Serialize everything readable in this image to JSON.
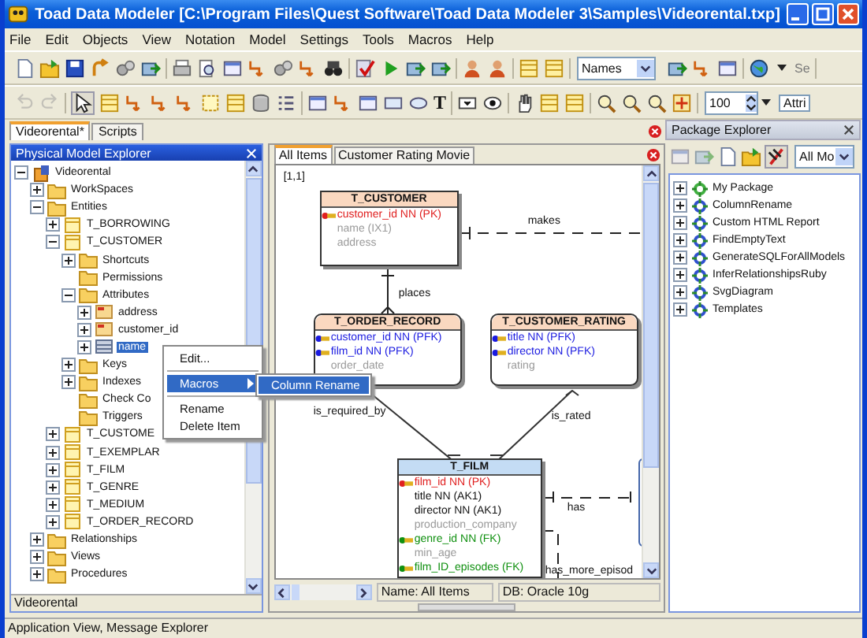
{
  "window": {
    "title": "Toad Data Modeler  [C:\\Program Files\\Quest Software\\Toad Data Modeler 3\\Samples\\Videorental.txp]"
  },
  "menu": [
    "File",
    "Edit",
    "Objects",
    "View",
    "Notation",
    "Model",
    "Settings",
    "Tools",
    "Macros",
    "Help"
  ],
  "toolbar": {
    "names_select": "Names",
    "search_text": "Se",
    "text_tool": "T",
    "zoom_value": "100",
    "attr_select": "Attri"
  },
  "document_tabs": [
    {
      "label": "Videorental*",
      "selected": true
    },
    {
      "label": "Scripts",
      "selected": false
    }
  ],
  "model_explorer": {
    "title": "Physical Model Explorer",
    "status": "Videorental",
    "tree": [
      {
        "label": "Videorental",
        "kind": "model",
        "expanded": true,
        "selected": false,
        "children": [
          {
            "label": "WorkSpaces",
            "kind": "folder",
            "expanded": false,
            "selected": false
          },
          {
            "label": "Entities",
            "kind": "folder",
            "expanded": true,
            "selected": false,
            "children": [
              {
                "label": "T_BORROWING",
                "kind": "entity",
                "expanded": false,
                "selected": false
              },
              {
                "label": "T_CUSTOMER",
                "kind": "entity",
                "expanded": true,
                "selected": false,
                "children": [
                  {
                    "label": "Shortcuts",
                    "kind": "folder",
                    "expanded": false,
                    "selected": false
                  },
                  {
                    "label": "Permissions",
                    "kind": "folder",
                    "selected": false
                  },
                  {
                    "label": "Attributes",
                    "kind": "folder",
                    "expanded": true,
                    "selected": false,
                    "children": [
                      {
                        "label": "address",
                        "kind": "key-attribute",
                        "expanded": false,
                        "selected": false
                      },
                      {
                        "label": "customer_id",
                        "kind": "key-attribute",
                        "expanded": false,
                        "selected": false
                      },
                      {
                        "label": "name",
                        "kind": "attribute",
                        "expanded": false,
                        "selected": true
                      }
                    ]
                  },
                  {
                    "label": "Keys",
                    "kind": "folder",
                    "expanded": false,
                    "selected": false
                  },
                  {
                    "label": "Indexes",
                    "kind": "folder",
                    "expanded": false,
                    "selected": false
                  },
                  {
                    "label": "Check Co",
                    "kind": "folder",
                    "selected": false
                  },
                  {
                    "label": "Triggers",
                    "kind": "folder",
                    "selected": false
                  }
                ]
              },
              {
                "label": "T_CUSTOME",
                "kind": "entity",
                "expanded": false,
                "selected": false
              },
              {
                "label": "T_EXEMPLAR",
                "kind": "entity",
                "expanded": false,
                "selected": false
              },
              {
                "label": "T_FILM",
                "kind": "entity",
                "expanded": false,
                "selected": false
              },
              {
                "label": "T_GENRE",
                "kind": "entity",
                "expanded": false,
                "selected": false
              },
              {
                "label": "T_MEDIUM",
                "kind": "entity",
                "expanded": false,
                "selected": false
              },
              {
                "label": "T_ORDER_RECORD",
                "kind": "entity",
                "expanded": false,
                "selected": false
              }
            ]
          },
          {
            "label": "Relationships",
            "kind": "folder",
            "expanded": false,
            "selected": false
          },
          {
            "label": "Views",
            "kind": "folder",
            "expanded": false,
            "selected": false
          },
          {
            "label": "Procedures",
            "kind": "folder",
            "expanded": false,
            "selected": false
          }
        ]
      }
    ]
  },
  "context_menu": {
    "items": [
      {
        "kind": "item",
        "label": "Edit...",
        "selected": false
      },
      {
        "kind": "separator"
      },
      {
        "kind": "submenu",
        "label": "Macros",
        "selected": true,
        "submenu": [
          {
            "label": "Column Rename",
            "selected": true
          }
        ]
      },
      {
        "kind": "separator"
      },
      {
        "kind": "item",
        "label": "Rename",
        "selected": false
      },
      {
        "kind": "item",
        "label": "Delete Item",
        "selected": false
      }
    ]
  },
  "diagram_tabs": [
    {
      "label": "All Items",
      "selected": true
    },
    {
      "label": "Customer Rating Movie",
      "selected": false
    }
  ],
  "diagram": {
    "corner_label": "[1,1]",
    "entities": [
      {
        "name": "T_CUSTOMER",
        "kind": "square",
        "selected": false,
        "attributes": [
          {
            "text": "customer_id NN (PK)",
            "kind": "pk"
          },
          {
            "text": "name (IX1)",
            "kind": "optional"
          },
          {
            "text": "address",
            "kind": "optional"
          }
        ]
      },
      {
        "name": "T_ORDER_RECORD",
        "kind": "rounded",
        "selected": false,
        "attributes": [
          {
            "text": "customer_id NN (PFK)",
            "kind": "pfk"
          },
          {
            "text": "film_id NN (PFK)",
            "kind": "pfk"
          },
          {
            "text": "order_date",
            "kind": "optional"
          }
        ]
      },
      {
        "name": "T_CUSTOMER_RATING",
        "kind": "rounded",
        "selected": false,
        "attributes": [
          {
            "text": "title NN (PFK)",
            "kind": "pfk"
          },
          {
            "text": "director NN (PFK)",
            "kind": "pfk"
          },
          {
            "text": "rating",
            "kind": "optional"
          }
        ]
      },
      {
        "name": "T_FILM",
        "kind": "square",
        "selected": true,
        "attributes": [
          {
            "text": "film_id NN (PK)",
            "kind": "pk"
          },
          {
            "text": "title NN (AK1)",
            "kind": "mandatory"
          },
          {
            "text": "director NN (AK1)",
            "kind": "mandatory"
          },
          {
            "text": "production_company",
            "kind": "optional"
          },
          {
            "text": "genre_id NN (FK)",
            "kind": "fk"
          },
          {
            "text": "min_age",
            "kind": "optional"
          },
          {
            "text": "film_ID_episodes (FK)",
            "kind": "fk"
          }
        ]
      }
    ],
    "relationships": [
      {
        "label": "makes",
        "identifying": false
      },
      {
        "label": "places",
        "identifying": true
      },
      {
        "label": "is_required_by",
        "identifying": true
      },
      {
        "label": "is_rated",
        "identifying": true
      },
      {
        "label": "has",
        "identifying": false
      },
      {
        "label": "has_more_episod",
        "identifying": false
      }
    ],
    "status": {
      "name": "Name: All Items",
      "db": "DB: Oracle 10g"
    }
  },
  "package_explorer": {
    "title": "Package Explorer",
    "filter": "All Mo",
    "packages": [
      {
        "label": "My Package",
        "kind": "user"
      },
      {
        "label": "ColumnRename",
        "kind": "macro"
      },
      {
        "label": "Custom HTML Report",
        "kind": "macro"
      },
      {
        "label": "FindEmptyText",
        "kind": "macro"
      },
      {
        "label": "GenerateSQLForAllModels",
        "kind": "macro"
      },
      {
        "label": "InferRelationshipsRuby",
        "kind": "macro"
      },
      {
        "label": "SvgDiagram",
        "kind": "macro"
      },
      {
        "label": "Templates",
        "kind": "macro"
      }
    ]
  },
  "status_bar": "Application View, Message Explorer"
}
